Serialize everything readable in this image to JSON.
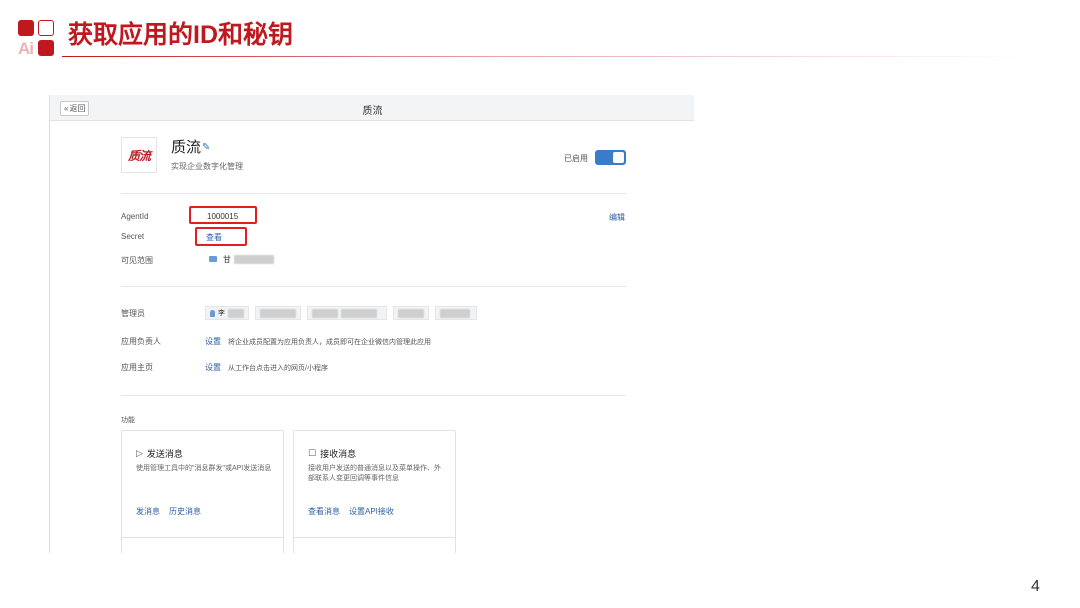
{
  "slide": {
    "logo_text": "Ai",
    "title": "获取应用的ID和秘钥",
    "page_number": "4",
    "accent_color": "#c0181f"
  },
  "window": {
    "back_label": "返回",
    "back_icon": "chevron-left-icon",
    "title": "质流"
  },
  "app": {
    "logo_text": "质流",
    "name": "质流",
    "edit_icon": "pencil-icon",
    "description": "实现企业数字化管理",
    "status_label": "已启用",
    "enabled": true,
    "toggle_color": "#3b7cc9"
  },
  "details": {
    "agentid_label": "AgentId",
    "agentid_value": "1000015",
    "secret_label": "Secret",
    "secret_link": "查看",
    "scope_label": "可见范围",
    "scope_value": "甘",
    "edit_link": "编辑"
  },
  "admin": {
    "admin_label": "管理员",
    "admin_first": "李",
    "owner_label": "应用负责人",
    "owner_link": "设置",
    "owner_desc": "将企业成员配置为应用负责人，成员即可在企业微信内管理此应用",
    "home_label": "应用主页",
    "home_link": "设置",
    "home_desc": "从工作台点击进入的网页/小程序"
  },
  "features": {
    "section_label": "功能",
    "cards": [
      {
        "icon": "send-icon",
        "title": "发送消息",
        "desc": "使用管理工具中的\"消息群发\"或API发送消息",
        "links": [
          "发消息",
          "历史消息"
        ]
      },
      {
        "icon": "chat-bubble-icon",
        "title": "接收消息",
        "desc": "接收用户发送的普通消息以及菜单操作、外部联系人变更回调等事件信息",
        "links": [
          "查看消息",
          "设置API接收"
        ]
      }
    ]
  }
}
